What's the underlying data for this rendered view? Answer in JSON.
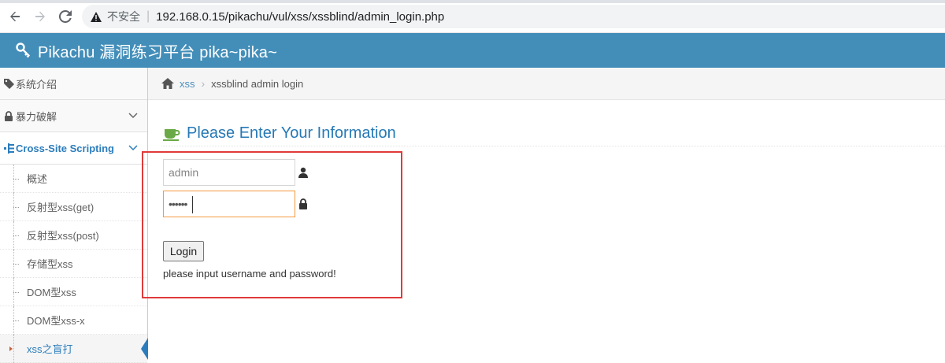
{
  "browser": {
    "insecure_label": "不安全",
    "url": "192.168.0.15/pikachu/vul/xss/xssblind/admin_login.php"
  },
  "banner": {
    "title": "Pikachu 漏洞练习平台 pika~pika~",
    "background": "#438eb9"
  },
  "sidebar": {
    "items": [
      {
        "label": "系统介绍",
        "icon": "tag-icon"
      },
      {
        "label": "暴力破解",
        "icon": "lock-icon"
      },
      {
        "label": "Cross-Site Scripting",
        "icon": "sitemap-icon"
      }
    ],
    "sub_items": [
      {
        "label": "概述"
      },
      {
        "label": "反射型xss(get)"
      },
      {
        "label": "反射型xss(post)"
      },
      {
        "label": "存储型xss"
      },
      {
        "label": "DOM型xss"
      },
      {
        "label": "DOM型xss-x"
      },
      {
        "label": "xss之盲打"
      }
    ]
  },
  "breadcrumb": {
    "link": "xss",
    "current": "xssblind admin login"
  },
  "main": {
    "title": "Please Enter Your Information",
    "username_value": "admin",
    "password_value": "••••••",
    "login_label": "Login",
    "hint": "please input username and password!"
  },
  "colors": {
    "accent": "#2b7dbc",
    "highlight_box": "#e03a3a",
    "focus_border": "#f59942"
  }
}
